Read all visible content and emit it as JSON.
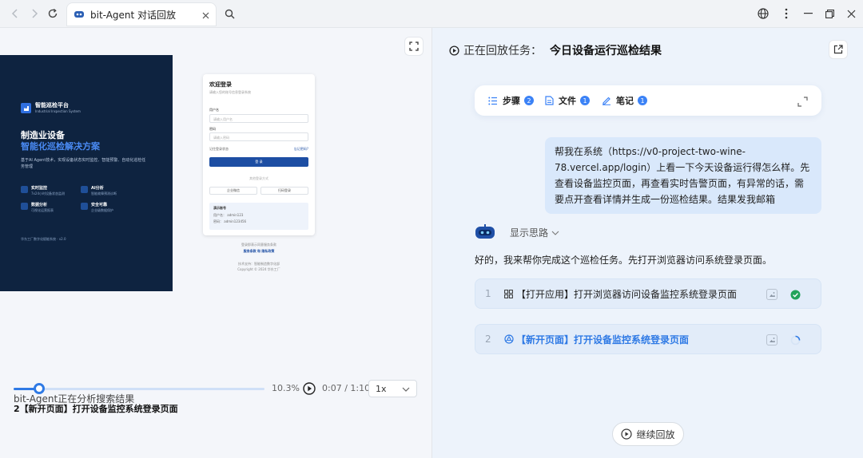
{
  "browser": {
    "tab_title": "bit-Agent 对话回放"
  },
  "preview": {
    "brand_name": "智能巡检平台",
    "brand_sub": "Industrial Inspection System",
    "hero_line1": "制造业设备",
    "hero_line2": "智能化巡检解决方案",
    "hero_desc": "基于AI Agent技术，实现设备状态实时监控、智能预警、自动化巡检任务管理",
    "features": [
      {
        "title": "实时监控",
        "desc": "7x24小时设备状态监测"
      },
      {
        "title": "AI分析",
        "desc": "智能故障预测诊断"
      },
      {
        "title": "数据分析",
        "desc": "可视化运营报表"
      },
      {
        "title": "安全可靠",
        "desc": "企业级数据保护"
      }
    ],
    "footer": "华东工厂数字化赋能系统 · v2.0",
    "login": {
      "title": "欢迎登录",
      "subtitle": "请输入您的账号信息登录系统",
      "user_label": "用户名",
      "user_placeholder": "请输入用户名",
      "pass_label": "密码",
      "pass_placeholder": "请输入密码",
      "remember": "记住登录状态",
      "forgot": "忘记密码?",
      "submit": "登 录",
      "or": "其他登录方式",
      "alt1": "企业微信",
      "alt2": "扫码登录",
      "demo_title": "演示账号",
      "demo_user": "用户名：  admin123",
      "demo_pass": "密码：    admin123456"
    },
    "below1": "登录即表示同意服务条款",
    "below2": "服务条款 和 隐私政策",
    "below3": "技术支持：智能制造数字化部",
    "below4": "Copyright © 2024 华东工厂"
  },
  "player": {
    "status": "bit-Agent正在分析搜索结果",
    "progress": 0.103,
    "progress_label": "10.3%",
    "time": "0:07 / 1:10",
    "speed": "1x",
    "current_step": "2【新开页面】打开设备监控系统登录页面"
  },
  "replay": {
    "label": "正在回放任务：",
    "task": "今日设备运行巡检结果",
    "toolbar": [
      {
        "label": "步骤",
        "count": "2"
      },
      {
        "label": "文件",
        "count": "1"
      },
      {
        "label": "笔记",
        "count": "1"
      }
    ],
    "user_message": "帮我在系统（https://v0-project-two-wine-78.vercel.app/login）上看一下今天设备运行得怎么样。先查看设备监控页面，再查看实时告警页面，有异常的话，需要点开查看详情并生成一份巡检结果。结果发我邮箱",
    "think_toggle": "显示思路",
    "agent_message": "好的，我来帮你完成这个巡检任务。先打开浏览器访问系统登录页面。",
    "steps": [
      {
        "num": "1",
        "title": "【打开应用】打开浏览器访问设备监控系统登录页面",
        "status": "done"
      },
      {
        "num": "2",
        "title": "【新开页面】打开设备监控系统登录页面",
        "status": "loading"
      }
    ],
    "continue": "继续回放"
  },
  "colors": {
    "accent": "#2f7ae5",
    "success": "#22a35a",
    "badge": "#3b82f6"
  }
}
